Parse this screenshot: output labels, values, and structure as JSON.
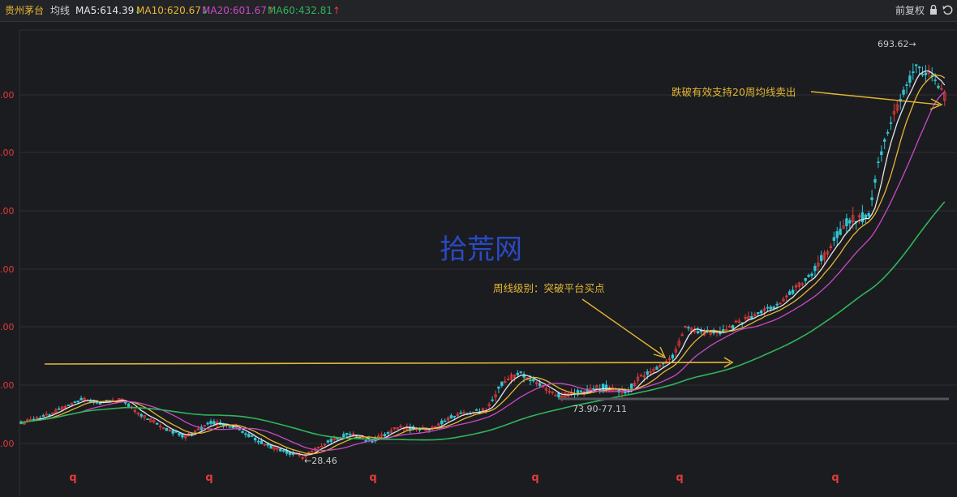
{
  "header": {
    "stock_name": "贵州茅台",
    "indicator": "均线",
    "ma5": "MA5:614.39",
    "ma5_arrow": "↓",
    "ma10": "MA10:620.67",
    "ma10_arrow": "↓",
    "ma20": "MA20:601.67",
    "ma20_arrow": "↑",
    "ma60": "MA60:432.81",
    "ma60_arrow": "↑",
    "adjust_label": "前复权",
    "lock_icon": "lock-icon",
    "reset_icon": "undo-icon"
  },
  "colors": {
    "ma5": "#e6e6e6",
    "ma10": "#e8b534",
    "ma20": "#c94ac4",
    "ma60": "#2fb55a",
    "up": "#e23b3b",
    "down": "#32c5d2",
    "annotation": "#e3b733",
    "watermark": "#2c4fd6",
    "axis_label": "#e23b3b"
  },
  "chart_data": {
    "type": "candlestick",
    "series": [
      {
        "name": "MA5"
      },
      {
        "name": "MA10"
      },
      {
        "name": "MA20"
      },
      {
        "name": "MA60"
      }
    ],
    "high_label": "693.62",
    "low_label": "28.46",
    "platform_label": "73.90-77.11",
    "annotation_sell": "跌破有效支持20周均线卖出",
    "annotation_buy": "周线级别：突破平台买点",
    "watermark": "拾荒网",
    "y_tick_labels": [
      ".00",
      ".00",
      ".00",
      ".00",
      ".00",
      ".00",
      ".00"
    ],
    "x_markers": [
      "q",
      "q",
      "q",
      "q",
      "q",
      "q"
    ]
  }
}
